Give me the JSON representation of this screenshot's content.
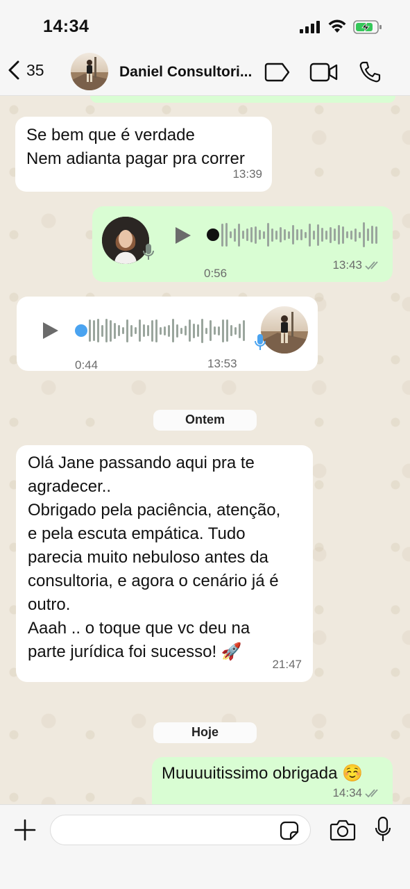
{
  "status_bar": {
    "time": "14:34"
  },
  "header": {
    "back_count": "35",
    "contact_name": "Daniel Consultori..."
  },
  "messages": {
    "m1_line1": "Se bem que é verdade",
    "m1_line2": "Nem adianta pagar pra correr",
    "m1_time": "13:39",
    "voice_out_duration": "0:56",
    "voice_out_time": "13:43",
    "voice_in_duration": "0:44",
    "voice_in_time": "13:53",
    "date_yesterday": "Ontem",
    "m2_lines": [
      "Olá Jane passando aqui pra te",
      "agradecer..",
      "Obrigado pela paciência, atenção,",
      "e pela escuta empática. Tudo",
      "parecia muito nebuloso antes da",
      "consultoria, e agora o cenário já é",
      "outro.",
      "Aaah .. o toque que vc deu na",
      "parte jurídica foi sucesso! 🚀"
    ],
    "m2_time": "21:47",
    "date_today": "Hoje",
    "m3_text": "Muuuuitissimo obrigada ☺️",
    "m3_time": "14:34"
  },
  "colors": {
    "outgoing_bubble": "#d9fdd3",
    "incoming_bubble": "#ffffff",
    "voice_progress_in": "#4aa3f0",
    "wallpaper": "#efe9de"
  },
  "icons": [
    "signal-icon",
    "wifi-icon",
    "battery-icon",
    "back-chevron-icon",
    "tag-icon",
    "video-call-icon",
    "phone-icon",
    "play-icon",
    "microphone-icon",
    "plus-icon",
    "sticker-icon",
    "camera-icon",
    "read-receipt-icon"
  ]
}
